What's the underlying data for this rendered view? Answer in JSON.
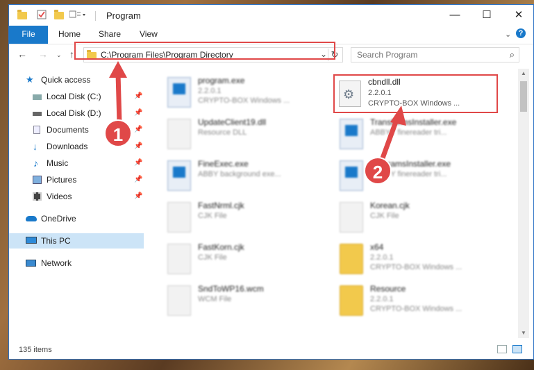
{
  "window": {
    "title": "Program",
    "controls": [
      "—",
      "☐",
      "✕"
    ]
  },
  "ribbon": {
    "tabs": [
      "File",
      "Home",
      "Share",
      "View"
    ],
    "help": "?"
  },
  "address": {
    "path": "C:\\Program Files\\Program Directory",
    "search_placeholder": "Search Program"
  },
  "navpane": {
    "items": [
      {
        "label": "Quick access",
        "pinned": false
      },
      {
        "label": "Local Disk (C:)",
        "pinned": true
      },
      {
        "label": "Local Disk (D:)",
        "pinned": true
      },
      {
        "label": "Documents",
        "pinned": true
      },
      {
        "label": "Downloads",
        "pinned": true
      },
      {
        "label": "Music",
        "pinned": true
      },
      {
        "label": "Pictures",
        "pinned": true
      },
      {
        "label": "Videos",
        "pinned": true
      },
      {
        "label": "OneDrive",
        "pinned": false
      },
      {
        "label": "This PC",
        "pinned": false,
        "selected": true
      },
      {
        "label": "Network",
        "pinned": false
      }
    ],
    "pin_glyph": "📌"
  },
  "files": [
    {
      "name": "program.exe",
      "line2": "2.2.0.1",
      "line3": "CRYPTO-BOX Windows ...",
      "icon": "exe-icon"
    },
    {
      "name": "cbndll.dll",
      "line2": "2.2.0.1",
      "line3": "CRYPTO-BOX Windows ...",
      "icon": "gear-file-icon",
      "highlighted": true
    },
    {
      "name": "UpdateClient19.dll",
      "line2": "Resource DLL",
      "line3": "",
      "icon": "file-icon"
    },
    {
      "name": "TransformsInstaller.exe",
      "line2": "ABBYY finereader tri...",
      "line3": "",
      "icon": "exe-icon"
    },
    {
      "name": "FineExec.exe",
      "line2": "ABBY background exe...",
      "line3": "",
      "icon": "exe-icon"
    },
    {
      "name": "ProgramsInstaller.exe",
      "line2": "ABBYY finereader tri...",
      "line3": "",
      "icon": "exe-icon"
    },
    {
      "name": "FastNrml.cjk",
      "line2": "CJK File",
      "line3": "",
      "icon": "file-icon"
    },
    {
      "name": "Korean.cjk",
      "line2": "CJK File",
      "line3": "",
      "icon": "file-icon"
    },
    {
      "name": "FastKorn.cjk",
      "line2": "CJK File",
      "line3": "",
      "icon": "file-icon"
    },
    {
      "name": "x64",
      "line2": "2.2.0.1",
      "line3": "CRYPTO-BOX Windows ...",
      "icon": "folder-icon"
    },
    {
      "name": "SndToWP16.wcm",
      "line2": "WCM File",
      "line3": "",
      "icon": "file-icon"
    },
    {
      "name": "Resource",
      "line2": "2.2.0.1",
      "line3": "CRYPTO-BOX Windows ...",
      "icon": "folder-icon"
    }
  ],
  "status": {
    "count": "135 items"
  },
  "annotations": {
    "badge1": "1",
    "badge2": "2"
  },
  "colors": {
    "accent": "#1979ca",
    "highlight": "#e04848",
    "selection": "#cce4f7"
  }
}
